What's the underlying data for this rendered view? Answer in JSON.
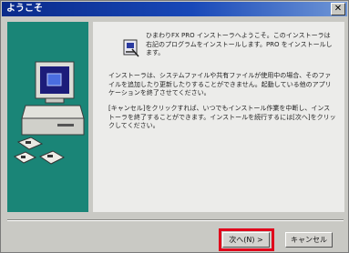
{
  "window": {
    "title": "ようこそ",
    "close_glyph": "✕"
  },
  "content": {
    "paragraph_1": "ひまわりFX PRO インストーラへようこそ。このインストーラは右記のプログラムをインストールします。PRO をインストールします。",
    "paragraph_2": "インストーラは、システムファイルや共有ファイルが使用中の場合、そのファイルを追加したり更新したりすることができません。起動している他のアプリケーションを終了させてください。",
    "paragraph_3": "[キャンセル]をクリックすれば、いつでもインストール作業を中断し、インストーラを終了することができます。インストールを続行するには[次へ]をクリックしてください。"
  },
  "buttons": {
    "next_label": "次へ(N) >",
    "cancel_label": "キャンセル"
  },
  "colors": {
    "side_panel": "#1a8577",
    "highlight": "#e0001b",
    "titlebar": "#0a2a8a"
  },
  "icons": [
    "computer-icon",
    "disk-icon",
    "floppy-icon",
    "welcome-icon",
    "close-icon"
  ]
}
